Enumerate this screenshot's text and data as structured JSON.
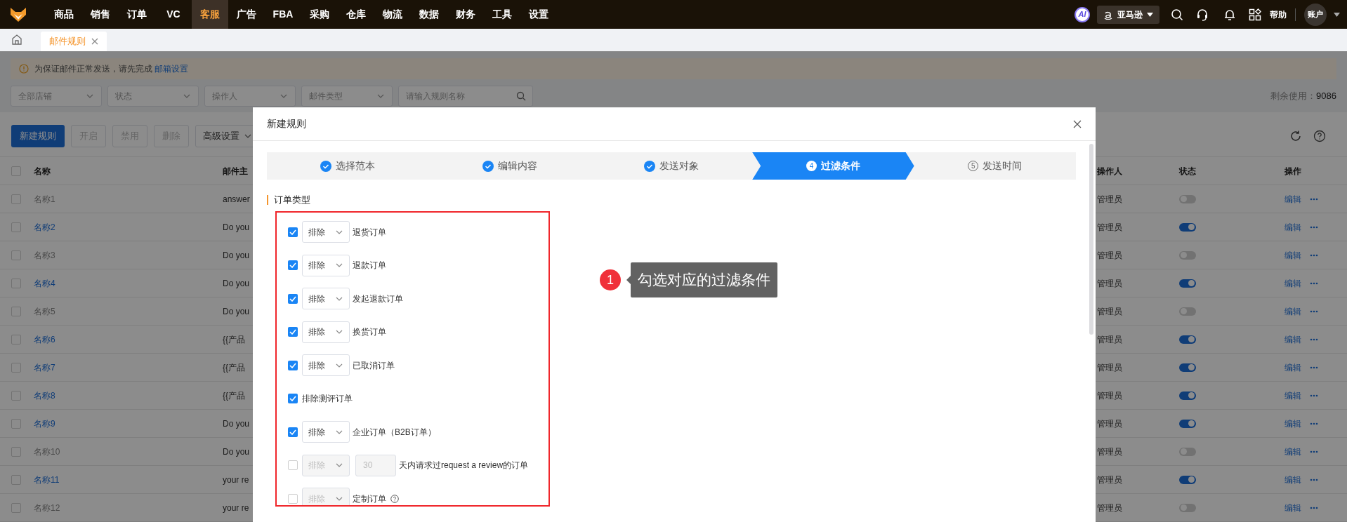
{
  "nav": {
    "items": [
      {
        "label": "商品",
        "selected": false
      },
      {
        "label": "销售",
        "selected": false
      },
      {
        "label": "订单",
        "selected": false
      },
      {
        "label": "VC",
        "selected": false
      },
      {
        "label": "客服",
        "selected": true
      },
      {
        "label": "广告",
        "selected": false
      },
      {
        "label": "FBA",
        "selected": false
      },
      {
        "label": "采购",
        "selected": false
      },
      {
        "label": "仓库",
        "selected": false
      },
      {
        "label": "物流",
        "selected": false
      },
      {
        "label": "数据",
        "selected": false
      },
      {
        "label": "财务",
        "selected": false
      },
      {
        "label": "工具",
        "selected": false
      },
      {
        "label": "设置",
        "selected": false
      }
    ],
    "ai_badge": "AI",
    "platform": "亚马逊",
    "help": "帮助",
    "account": "账户"
  },
  "tabs": [
    {
      "label": "邮件规则",
      "selected": true
    }
  ],
  "alert": {
    "text": "为保证邮件正常发送，请先完成",
    "link": "邮箱设置"
  },
  "filters": [
    {
      "placeholder": "全部店铺"
    },
    {
      "placeholder": "状态"
    },
    {
      "placeholder": "操作人"
    },
    {
      "placeholder": "邮件类型"
    }
  ],
  "search": {
    "placeholder": "请输入规则名称"
  },
  "remaining": {
    "label": "剩余使用：",
    "value": "9086"
  },
  "toolbar": {
    "primary": "新建规则",
    "buttons": [
      "开启",
      "禁用",
      "删除"
    ],
    "dropdown": "高级设置"
  },
  "table": {
    "all_checked": false,
    "columns": [
      "名称",
      "邮件主",
      "操作人",
      "状态",
      "操作"
    ],
    "rows": [
      {
        "checked": false,
        "name": "名称1",
        "subject": "answer",
        "operator": "管理员",
        "enabled": false,
        "action": "编辑"
      },
      {
        "checked": false,
        "name": "名称2",
        "subject": "Do you",
        "operator": "管理员",
        "enabled": true,
        "action": "编辑"
      },
      {
        "checked": false,
        "name": "名称3",
        "subject": "Do you",
        "operator": "管理员",
        "enabled": false,
        "action": "编辑"
      },
      {
        "checked": false,
        "name": "名称4",
        "subject": "Do you",
        "operator": "管理员",
        "enabled": true,
        "action": "编辑"
      },
      {
        "checked": false,
        "name": "名称5",
        "subject": "Do you",
        "operator": "管理员",
        "enabled": false,
        "action": "编辑"
      },
      {
        "checked": false,
        "name": "名称6",
        "subject": "{{产品",
        "operator": "管理员",
        "enabled": true,
        "action": "编辑"
      },
      {
        "checked": false,
        "name": "名称7",
        "subject": "{{产品",
        "operator": "管理员",
        "enabled": true,
        "action": "编辑"
      },
      {
        "checked": false,
        "name": "名称8",
        "subject": "{{产品",
        "operator": "管理员",
        "enabled": true,
        "action": "编辑"
      },
      {
        "checked": false,
        "name": "名称9",
        "subject": "Do you",
        "operator": "管理员",
        "enabled": true,
        "action": "编辑"
      },
      {
        "checked": false,
        "name": "名称10",
        "subject": "Do you",
        "operator": "管理员",
        "enabled": false,
        "action": "编辑"
      },
      {
        "checked": false,
        "name": "名称11",
        "subject": "your re",
        "operator": "管理员",
        "enabled": true,
        "action": "编辑"
      },
      {
        "checked": false,
        "name": "名称12",
        "subject": "your re",
        "operator": "管理员",
        "enabled": false,
        "action": "编辑"
      }
    ]
  },
  "dialog": {
    "title": "新建规则",
    "steps": [
      {
        "label": "选择范本",
        "done": true,
        "selected": false
      },
      {
        "label": "编辑内容",
        "done": true,
        "selected": false
      },
      {
        "label": "发送对象",
        "done": true,
        "selected": false
      },
      {
        "label": "过滤条件",
        "done": false,
        "selected": true,
        "num": "4"
      },
      {
        "label": "发送时间",
        "done": false,
        "selected": false,
        "num": "5"
      }
    ],
    "section": "订单类型",
    "conditions": [
      {
        "kind": "select",
        "checked": true,
        "mode": "排除",
        "label": "退货订单"
      },
      {
        "kind": "select",
        "checked": true,
        "mode": "排除",
        "label": "退款订单"
      },
      {
        "kind": "select",
        "checked": true,
        "mode": "排除",
        "label": "发起退款订单"
      },
      {
        "kind": "select",
        "checked": true,
        "mode": "排除",
        "label": "换货订单"
      },
      {
        "kind": "select",
        "checked": true,
        "mode": "排除",
        "label": "已取消订单"
      },
      {
        "kind": "plain",
        "checked": true,
        "label": "排除测评订单"
      },
      {
        "kind": "select",
        "checked": true,
        "mode": "排除",
        "label": "企业订单（B2B订单）"
      },
      {
        "kind": "days",
        "checked": false,
        "mode": "排除",
        "days": "30",
        "label": "天内请求过request a review的订单"
      },
      {
        "kind": "select",
        "checked": false,
        "mode": "排除",
        "label": "定制订单",
        "help": true
      }
    ],
    "callout": {
      "badge": "1",
      "text": "勾选对应的过滤条件"
    }
  }
}
